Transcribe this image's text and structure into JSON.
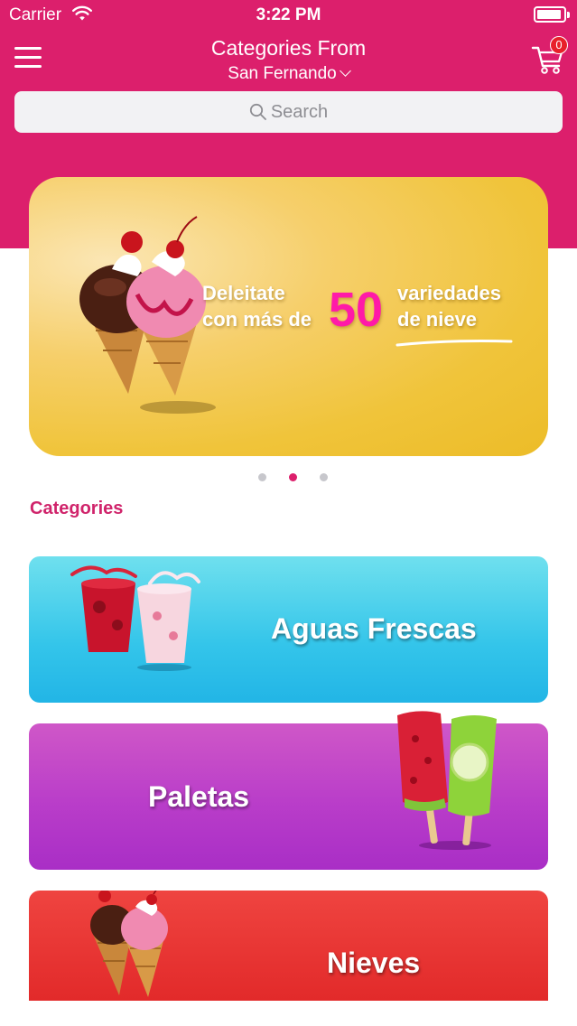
{
  "status_bar": {
    "carrier": "Carrier",
    "time": "3:22 PM"
  },
  "nav": {
    "title": "Categories From",
    "location": "San Fernando",
    "cart_count": "0"
  },
  "search": {
    "placeholder": "Search"
  },
  "banner": {
    "line1_left": "Deleitate",
    "line2_left": "con más de",
    "number": "50",
    "line1_right": "variedades",
    "line2_right": "de nieve",
    "page_count": 3,
    "active_page": 2
  },
  "section": {
    "title": "Categories"
  },
  "categories": [
    {
      "label": "Aguas Frescas",
      "color": "#34c5ea"
    },
    {
      "label": "Paletas",
      "color": "#b93dc9"
    },
    {
      "label": "Nieves",
      "color": "#e22a2a"
    }
  ],
  "colors": {
    "brand": "#dc1f6c",
    "accent_pink": "#ff1aa8",
    "badge": "#e8202a"
  },
  "icons": [
    "wifi-icon",
    "battery-icon",
    "menu-icon",
    "cart-icon",
    "search-icon",
    "chevron-down-icon"
  ]
}
